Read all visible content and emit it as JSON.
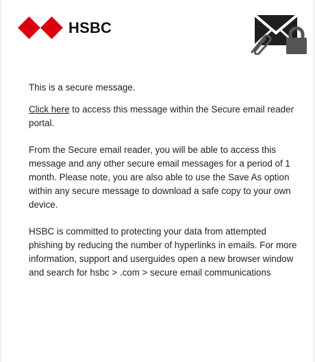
{
  "brand": {
    "name": "HSBC",
    "logo_icon": "hsbc-hexagon-logo",
    "logo_color": "#db0011"
  },
  "header_icon": "secure-mail-lock-icon",
  "message": {
    "intro": "This is a secure message.",
    "link_text": "Click here",
    "link_suffix": " to access this message within the Secure email reader portal.",
    "para2": "From the Secure email reader, you will be able to access this message and any other secure email messages for a period of 1 month. Please note, you are also able to use the Save As option within any secure message to download a safe copy to your own device.",
    "para3": "HSBC is committed to protecting your data from attempted phishing by reducing the number of hyperlinks in emails. For more information, support and userguides open a new browser window and search for hsbc > .com > secure email communications"
  }
}
